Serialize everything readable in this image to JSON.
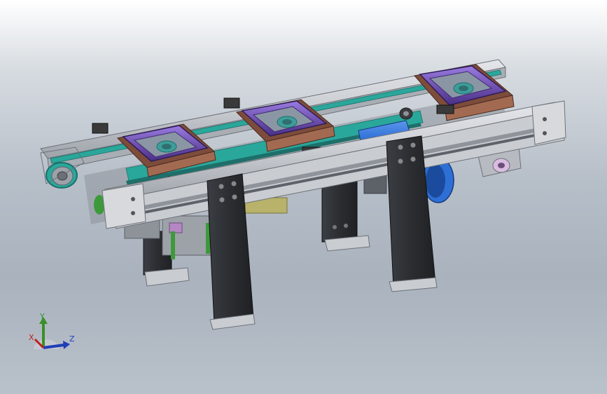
{
  "viewport": {
    "background_top": "#ffffff",
    "background_mid": "#b7bfc9",
    "background_bottom": "#b9c1ca"
  },
  "model": {
    "colors": {
      "frame_aluminum": "#c9ccd1",
      "frame_shadow": "#8f949b",
      "frame_dark": "#5d6168",
      "belt_teal": "#2aa79b",
      "belt_dark": "#1d6f6a",
      "fixture_purple": "#6f4fb1",
      "fixture_purple_dark": "#3f2a72",
      "fixture_brown": "#7d4c3a",
      "fixture_brown_light": "#a36a52",
      "fixture_teal_insert": "#3d9d9a",
      "leg_black": "#2d2f33",
      "motor_blue": "#2e6fd6",
      "motor_blue_dark": "#1b4b9c",
      "drive_green": "#3c9a3a",
      "sensor_black": "#3a3a3a",
      "bracket_pink": "#b487c4",
      "bracket_yellow": "#b8b26a"
    },
    "legs": 4,
    "fixtures": 3
  },
  "triad": {
    "x_label": "X",
    "y_label": "Y",
    "z_label": "Z",
    "x_color": "#c21d1d",
    "y_color": "#3a8f2a",
    "z_color": "#1f3fb8"
  }
}
